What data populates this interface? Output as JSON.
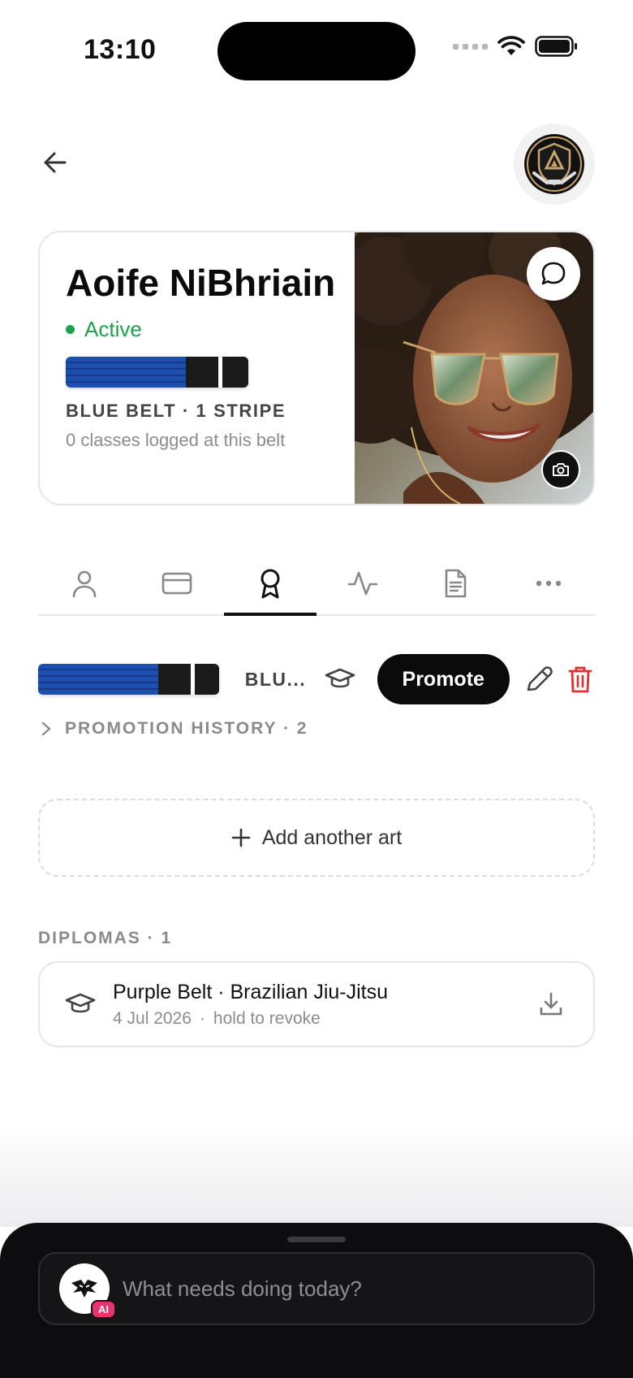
{
  "status_bar": {
    "time": "13:10"
  },
  "header": {
    "back_icon": "arrow-left-icon",
    "logo_icon": "club-shield-logo"
  },
  "profile": {
    "name": "Aoife NiBhriain",
    "status": "Active",
    "status_color": "#1aa34a",
    "belt_color": "#1d4fb0",
    "belt_rank": "BLUE BELT · 1 STRIPE",
    "classes_note": "0 classes logged at this belt",
    "stripes": 1
  },
  "tabs": [
    {
      "icon": "person-icon",
      "active": false
    },
    {
      "icon": "card-icon",
      "active": false
    },
    {
      "icon": "award-icon",
      "active": true
    },
    {
      "icon": "activity-icon",
      "active": false
    },
    {
      "icon": "document-icon",
      "active": false
    },
    {
      "icon": "more-icon",
      "active": false
    }
  ],
  "art": {
    "name": "BLU...",
    "promote_label": "Promote",
    "promotion_history_label": "PROMOTION HISTORY · 2"
  },
  "add_art": {
    "label": "Add another art"
  },
  "diplomas": {
    "heading": "DIPLOMAS · 1",
    "items": [
      {
        "title": "Purple Belt · Brazilian Jiu-Jitsu",
        "date": "4 Jul 2026",
        "separator": "·",
        "hint": "hold to revoke"
      }
    ]
  },
  "ai_bar": {
    "placeholder": "What needs doing today?",
    "badge": "AI"
  },
  "colors": {
    "accent": "#0b0b0b",
    "danger": "#e03131",
    "ai_badge": "#e8336f"
  }
}
